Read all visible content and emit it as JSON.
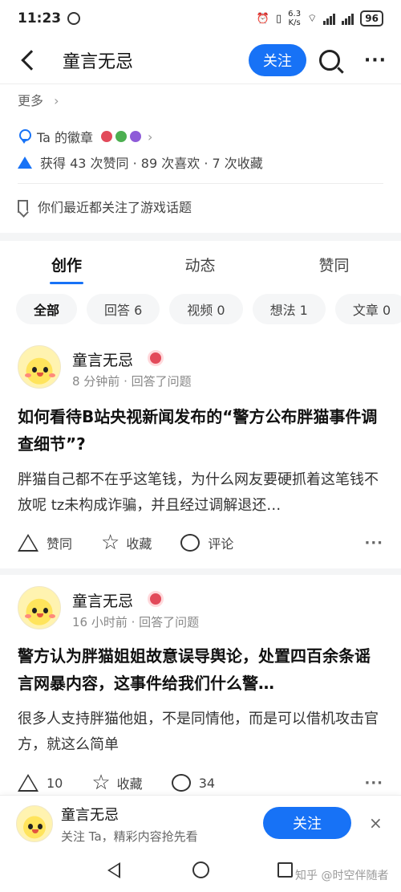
{
  "status": {
    "time": "11:23",
    "speed_value": "6.3",
    "speed_unit": "K/s",
    "battery": "96"
  },
  "header": {
    "title": "童言无忌",
    "follow_label": "关注"
  },
  "profile": {
    "more_label": "更多",
    "badge_label": "Ta 的徽章",
    "stats": "获得 43 次赞同 · 89 次喜欢 · 7 次收藏",
    "recent": "你们最近都关注了游戏话题"
  },
  "tabs": [
    {
      "label": "创作",
      "active": true
    },
    {
      "label": "动态",
      "active": false
    },
    {
      "label": "赞同",
      "active": false
    }
  ],
  "filters": [
    {
      "label": "全部",
      "active": true
    },
    {
      "label": "回答 6"
    },
    {
      "label": "视频 0"
    },
    {
      "label": "想法 1"
    },
    {
      "label": "文章 0"
    }
  ],
  "feed": [
    {
      "author": "童言无忌",
      "meta": "8 分钟前 · 回答了问题",
      "title": "如何看待B站央视新闻发布的“警方公布胖猫事件调查细节”?",
      "excerpt": "胖猫自己都不在乎这笔钱，为什么网友要硬抓着这笔钱不放呢 tz未构成诈骗，并且经过调解退还…",
      "upvote_label": "赞同",
      "favorite_label": "收藏",
      "comment_label": "评论"
    },
    {
      "author": "童言无忌",
      "meta": "16 小时前 · 回答了问题",
      "title": "警方认为胖猫姐姐故意误导舆论，处置四百余条谣言网暴内容，这事件给我们什么警…",
      "excerpt": "很多人支持胖猫他姐，不是同情他，而是可以借机攻击官方，就这么简单",
      "upvote_label": "10",
      "favorite_label": "收藏",
      "comment_label": "34"
    }
  ],
  "follow_bar": {
    "name": "童言无忌",
    "subtitle": "关注 Ta，精彩内容抢先看",
    "button": "关注",
    "close": "×"
  },
  "watermark": "知乎 @时空伴随者",
  "colors": {
    "accent": "#1772f6",
    "badge_red": "#e24a5a"
  }
}
